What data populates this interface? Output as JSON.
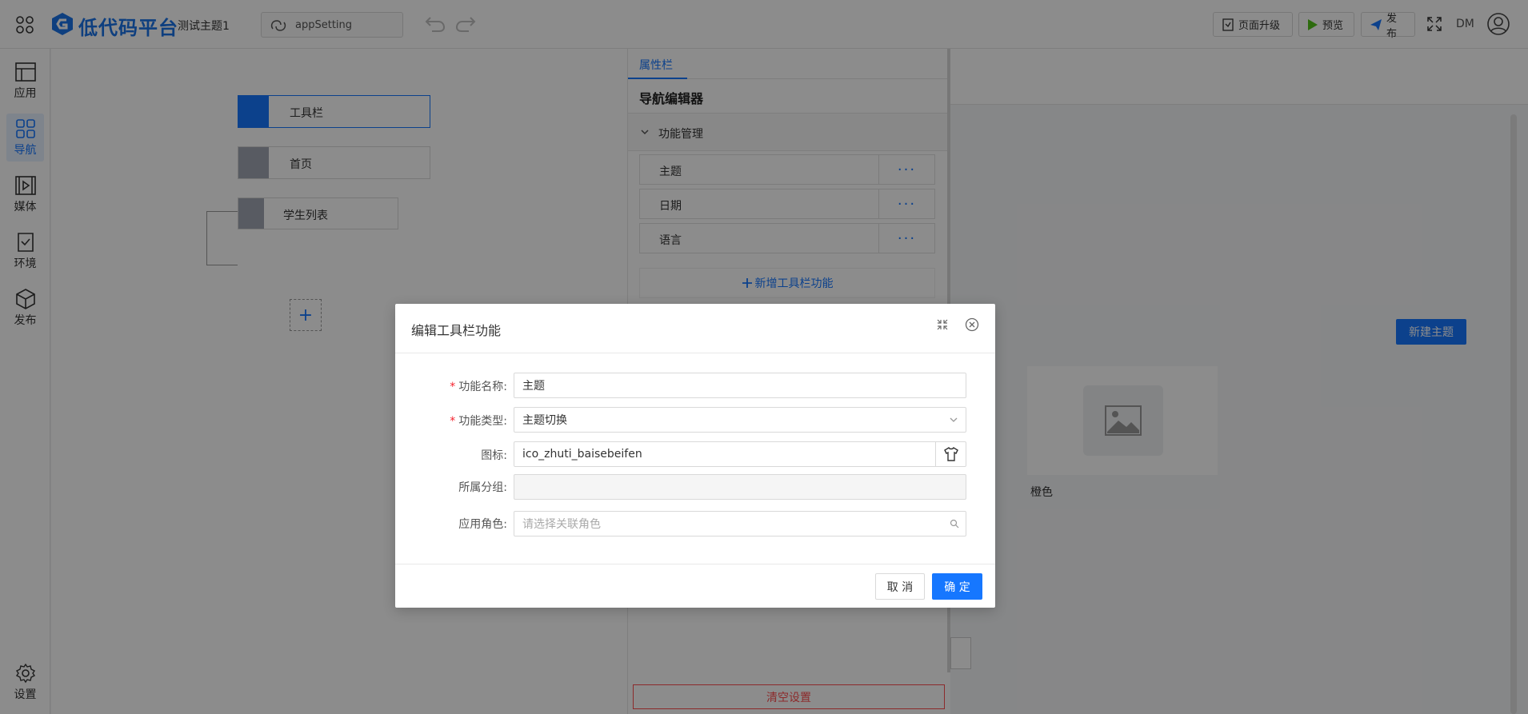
{
  "header": {
    "logo_text": "低代码平台",
    "theme_name": "测试主题1",
    "app_select": "appSetting",
    "buttons": {
      "upgrade": "页面升级",
      "preview": "预览",
      "publish": "发布"
    },
    "user": "DM"
  },
  "sidebar": {
    "items": [
      {
        "label": "应用",
        "icon": "layout-icon"
      },
      {
        "label": "导航",
        "icon": "grid-icon"
      },
      {
        "label": "媒体",
        "icon": "media-icon"
      },
      {
        "label": "环境",
        "icon": "env-icon"
      },
      {
        "label": "发布",
        "icon": "box-icon"
      }
    ],
    "settings": "设置"
  },
  "canvas": {
    "nodes": [
      {
        "label": "工具栏",
        "selected": true
      },
      {
        "label": "首页",
        "selected": false
      },
      {
        "label": "学生列表",
        "selected": false
      }
    ],
    "add_symbol": "+"
  },
  "panel": {
    "tab": "属性栏",
    "title": "导航编辑器",
    "section": "功能管理",
    "functions": [
      {
        "name": "主题",
        "more": "···"
      },
      {
        "name": "日期",
        "more": "···"
      },
      {
        "name": "语言",
        "more": "···"
      }
    ],
    "add_function": "新增工具栏功能",
    "clear": "清空设置"
  },
  "preview": {
    "new_theme": "新建主题",
    "theme_card_name": "橙色"
  },
  "dialog": {
    "title": "编辑工具栏功能",
    "fields": {
      "name": {
        "label": "功能名称:",
        "value": "主题",
        "required": true
      },
      "type": {
        "label": "功能类型:",
        "value": "主题切换",
        "required": true
      },
      "icon": {
        "label": "图标:",
        "value": "ico_zhuti_baisebeifen"
      },
      "group": {
        "label": "所属分组:",
        "value": ""
      },
      "role": {
        "label": "应用角色:",
        "placeholder": "请选择关联角色"
      }
    },
    "cancel": "取 消",
    "ok": "确 定"
  },
  "colors": {
    "primary": "#1677ff",
    "danger": "#ff4d4f",
    "overlay": "rgba(0,0,0,0.45)"
  }
}
